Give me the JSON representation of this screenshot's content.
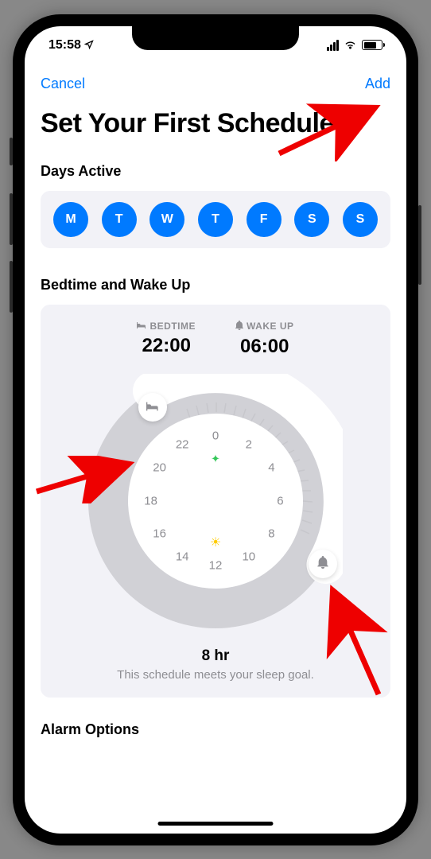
{
  "status": {
    "time": "15:58"
  },
  "nav": {
    "cancel": "Cancel",
    "add": "Add"
  },
  "title": "Set Your First Schedule",
  "days": {
    "title": "Days Active",
    "items": [
      "M",
      "T",
      "W",
      "T",
      "F",
      "S",
      "S"
    ]
  },
  "bedtime": {
    "title": "Bedtime and Wake Up",
    "bedtime_label": "BEDTIME",
    "bedtime_value": "22:00",
    "wakeup_label": "WAKE UP",
    "wakeup_value": "06:00",
    "clock": [
      "0",
      "2",
      "4",
      "6",
      "8",
      "10",
      "12",
      "14",
      "16",
      "18",
      "20",
      "22"
    ],
    "summary_hours": "8 hr",
    "summary_text": "This schedule meets your sleep goal."
  },
  "alarm": {
    "title": "Alarm Options"
  }
}
